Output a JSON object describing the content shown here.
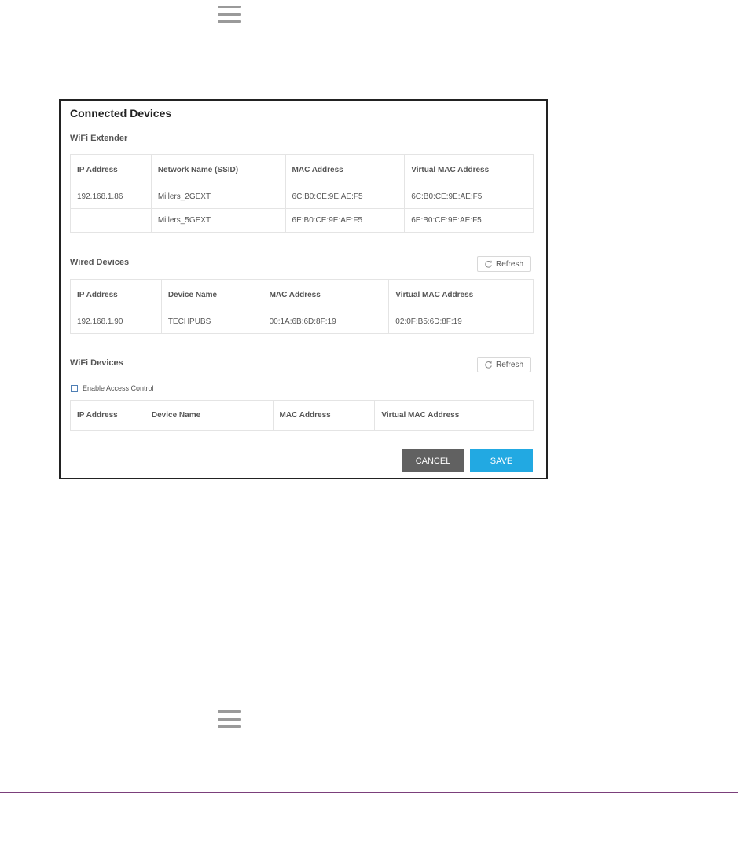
{
  "panel": {
    "title": "Connected Devices"
  },
  "wifi_extender": {
    "title": "WiFi Extender",
    "columns": [
      "IP Address",
      "Network Name (SSID)",
      "MAC Address",
      "Virtual MAC Address"
    ],
    "rows": [
      [
        "192.168.1.86",
        "Millers_2GEXT",
        "6C:B0:CE:9E:AE:F5",
        "6C:B0:CE:9E:AE:F5"
      ],
      [
        "",
        "Millers_5GEXT",
        "6E:B0:CE:9E:AE:F5",
        "6E:B0:CE:9E:AE:F5"
      ]
    ]
  },
  "wired_devices": {
    "title": "Wired Devices",
    "refresh_label": "Refresh",
    "columns": [
      "IP Address",
      "Device Name",
      "MAC Address",
      "Virtual MAC Address"
    ],
    "rows": [
      [
        "192.168.1.90",
        "TECHPUBS",
        "00:1A:6B:6D:8F:19",
        "02:0F:B5:6D:8F:19"
      ]
    ]
  },
  "wifi_devices": {
    "title": "WiFi Devices",
    "refresh_label": "Refresh",
    "access_control_label": "Enable Access Control",
    "access_control_checked": false,
    "columns": [
      "IP Address",
      "Device Name",
      "MAC Address",
      "Virtual MAC Address"
    ]
  },
  "actions": {
    "cancel_label": "CANCEL",
    "save_label": "SAVE"
  },
  "icons": {
    "menu": "hamburger-menu-icon",
    "refresh": "refresh-icon"
  },
  "colors": {
    "save": "#22a9e2",
    "cancel": "#616161",
    "rule": "#7b3f7b"
  }
}
